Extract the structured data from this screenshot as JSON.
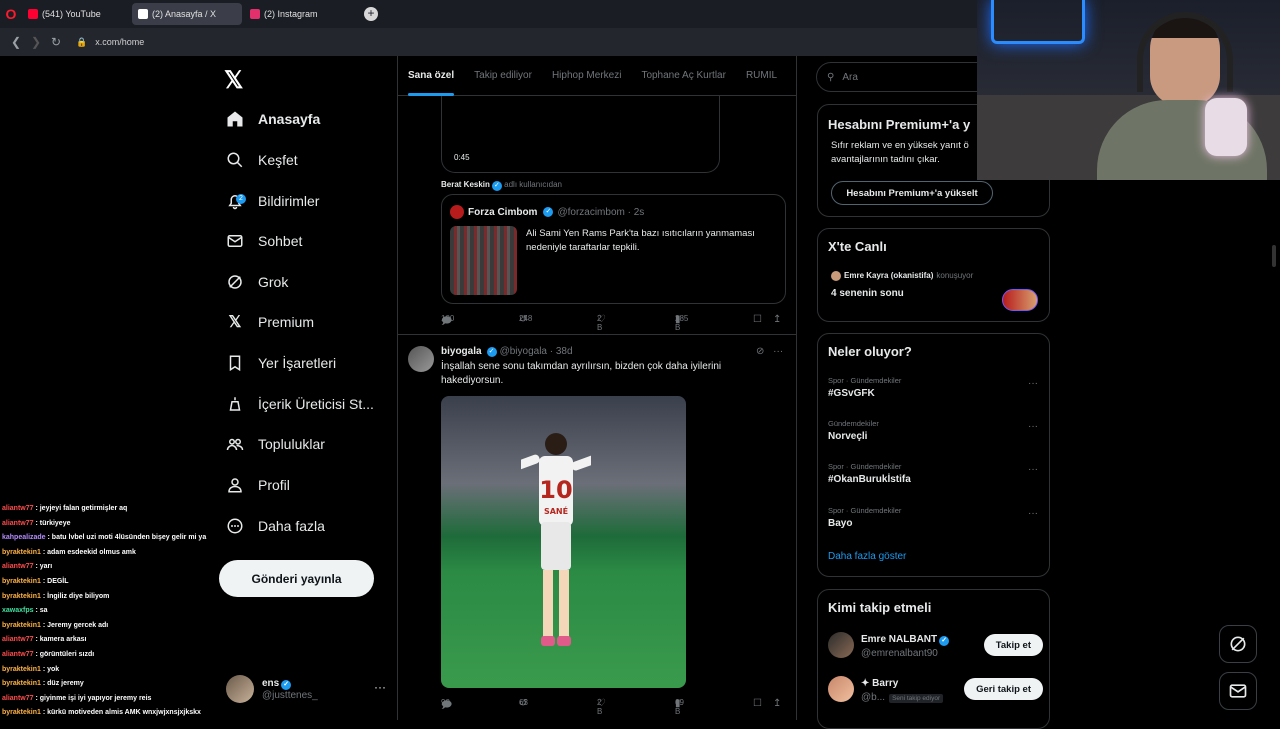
{
  "browser": {
    "tabs": [
      {
        "label": "(541) YouTube",
        "color": "#ff0033"
      },
      {
        "label": "(2) Anasayfa / X",
        "color": "#ffffff",
        "active": true
      },
      {
        "label": "(2) Instagram",
        "color": "#e1306c"
      }
    ],
    "new_tab": "+",
    "url": "x.com/home"
  },
  "nav": {
    "items": [
      {
        "label": "Anasayfa",
        "icon": "home-icon"
      },
      {
        "label": "Keşfet",
        "icon": "search-icon"
      },
      {
        "label": "Bildirimler",
        "icon": "bell-icon",
        "badge": "2"
      },
      {
        "label": "Sohbet",
        "icon": "mail-icon"
      },
      {
        "label": "Grok",
        "icon": "grok-icon"
      },
      {
        "label": "Premium",
        "icon": "x-logo-icon"
      },
      {
        "label": "Yer İşaretleri",
        "icon": "bookmark-icon"
      },
      {
        "label": "İçerik Üreticisi St...",
        "icon": "creator-icon"
      },
      {
        "label": "Topluluklar",
        "icon": "communities-icon"
      },
      {
        "label": "Profil",
        "icon": "profile-icon"
      },
      {
        "label": "Daha fazla",
        "icon": "more-circle-icon"
      }
    ],
    "post_button": "Gönderi yayınla",
    "account": {
      "name": "ens",
      "handle": "@justtenes_",
      "more": "···"
    }
  },
  "chat": [
    {
      "user": "aliantw77",
      "color": "#ff4d4d",
      "msg": ": jeyjeyi falan getirmişler aq"
    },
    {
      "user": "aliantw77",
      "color": "#ff4d4d",
      "msg": ": türkiyeye"
    },
    {
      "user": "kahpealizade",
      "color": "#b48cff",
      "msg": ": batu lvbel uzi moti 4lüsünden bişey gelir mi ya"
    },
    {
      "user": "byraktekin1",
      "color": "#ffb347",
      "msg": ": adam esdeekid olmus amk"
    },
    {
      "user": "aliantw77",
      "color": "#ff4d4d",
      "msg": ": yarı"
    },
    {
      "user": "byraktekin1",
      "color": "#ffb347",
      "msg": ": DEGİL"
    },
    {
      "user": "byraktekin1",
      "color": "#ffb347",
      "msg": ": İngiliz diye biliyom"
    },
    {
      "user": "xawaxfps",
      "color": "#40e0a0",
      "msg": ": sa"
    },
    {
      "user": "byraktekin1",
      "color": "#ffb347",
      "msg": ": Jeremy gercek adı"
    },
    {
      "user": "aliantw77",
      "color": "#ff4d4d",
      "msg": ": kamera arkası"
    },
    {
      "user": "aliantw77",
      "color": "#ff4d4d",
      "msg": ": görüntüleri sızdı"
    },
    {
      "user": "byraktekin1",
      "color": "#ffb347",
      "msg": ": yok"
    },
    {
      "user": "byraktekin1",
      "color": "#ffb347",
      "msg": ": düz jeremy"
    },
    {
      "user": "aliantw77",
      "color": "#ff4d4d",
      "msg": ": giyinme işi iyi yapıyor jeremy reis"
    },
    {
      "user": "byraktekin1",
      "color": "#ffb347",
      "msg": ": kürkü motiveden almis AMK wnxjwjxnsjxjkskx"
    }
  ],
  "timeline": {
    "tabs": [
      "Sana özel",
      "Takip ediliyor",
      "Hiphop Merkezi",
      "Tophane Aç Kurtlar",
      "RUMIL"
    ],
    "video_duration": "0:45",
    "repost": {
      "name": "Berat Keskin",
      "suffix": "adlı kullanıcıdan"
    },
    "quote": {
      "name": "Forza Cimbom",
      "handle": "@forzacimbom · 2s",
      "text": "Ali Sami Yen Rams Park'ta bazı ısıtıcıların yanmaması nedeniyle taraftarlar tepkili."
    },
    "actions1": {
      "replies": "100",
      "reposts": "248",
      "likes": "2 B",
      "views": "285 B"
    },
    "tweet2": {
      "name": "biyogala",
      "handle": "@biyogala · 38d",
      "text": "İnşallah sene sonu takımdan ayrılırsın, bizden çok daha iyilerini hakediyorsun.",
      "jersey_number": "10",
      "jersey_name": "SANÉ"
    },
    "actions2": {
      "replies": "90",
      "reposts": "63",
      "likes": "2 B",
      "views": "69 B"
    }
  },
  "right": {
    "search_placeholder": "Ara",
    "premium": {
      "title": "Hesabını Premium+'a y",
      "text1": "Sıfır reklam ve en yüksek yanıt ö",
      "text2": "avantajlarının tadını çıkar.",
      "button": "Hesabını Premium+'a yükselt"
    },
    "live": {
      "title": "X'te Canlı",
      "host": "Emre Kayra (okanistifa)",
      "host_suffix": "konuşuyor",
      "topic": "4 senenin sonu"
    },
    "trends": {
      "title": "Neler oluyor?",
      "items": [
        {
          "category": "Spor · Gündemdekiler",
          "name": "#GSvGFK"
        },
        {
          "category": "Gündemdekiler",
          "name": "Norveçli"
        },
        {
          "category": "Spor · Gündemdekiler",
          "name": "#OkanBurukİstifa"
        },
        {
          "category": "Spor · Gündemdekiler",
          "name": "Bayo"
        }
      ],
      "show_more": "Daha fazla göster"
    },
    "who_to_follow": {
      "title": "Kimi takip etmeli",
      "items": [
        {
          "name": "Emre NALBANT",
          "handle": "@emrenalbant90",
          "button": "Takip et"
        },
        {
          "name": "✦ Barry",
          "handle": "@b...",
          "badge": "Seni takip ediyor",
          "button": "Geri takip et"
        }
      ]
    }
  }
}
